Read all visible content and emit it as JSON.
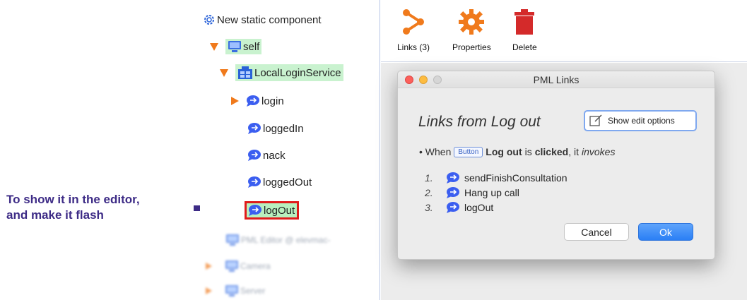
{
  "annotation": {
    "line1": "To show it in the editor,",
    "line2": "and make it flash"
  },
  "tree": {
    "root_label": "New static component",
    "self_label": "self",
    "service_label": "LocalLoginService",
    "items": [
      {
        "label": "login",
        "expandable": true
      },
      {
        "label": "loggedIn",
        "expandable": false
      },
      {
        "label": "nack",
        "expandable": false
      },
      {
        "label": "loggedOut",
        "expandable": false
      },
      {
        "label": "logOut",
        "expandable": false,
        "selected": true
      }
    ],
    "blurred_items": [
      {
        "label": "PML Editor @ elevmac-"
      },
      {
        "label": "Camera"
      },
      {
        "label": "Server"
      }
    ]
  },
  "toolbar": {
    "links_label": "Links (3)",
    "properties_label": "Properties",
    "delete_label": "Delete"
  },
  "dialog": {
    "title": "PML Links",
    "heading": "Links from Log out",
    "edit_options_label": "Show edit options",
    "when_prefix": "• When",
    "button_tag": "Button",
    "element_name": "Log out",
    "is_word": "is",
    "event": "clicked",
    "it_word": ", it",
    "invokes_word": "invokes",
    "invocations": [
      {
        "num": "1.",
        "label": "sendFinishConsultation"
      },
      {
        "num": "2.",
        "label": "Hang up call"
      },
      {
        "num": "3.",
        "label": "logOut"
      }
    ],
    "cancel_label": "Cancel",
    "ok_label": "Ok"
  },
  "colors": {
    "accent_orange": "#f07a1c",
    "delete_red": "#d42a2a",
    "highlight_green": "#c9f2cf",
    "selection_red": "#e01b1b",
    "annotation_purple": "#3d2b86",
    "ok_blue": "#2a7ff5"
  }
}
